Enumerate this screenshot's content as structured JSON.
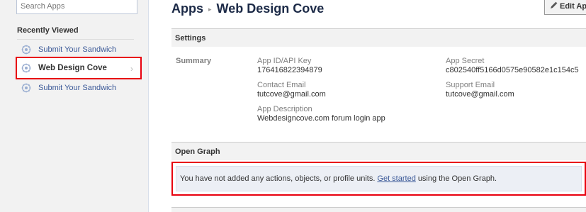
{
  "sidebar": {
    "search_placeholder": "Search Apps",
    "recent_heading": "Recently Viewed",
    "items": [
      {
        "label": "Submit Your Sandwich",
        "active": false
      },
      {
        "label": "Web Design Cove",
        "active": true
      },
      {
        "label": "Submit Your Sandwich",
        "active": false
      }
    ]
  },
  "header": {
    "apps": "Apps",
    "separator": "▸",
    "app_name": "Web Design Cove",
    "edit_label": "Edit Ap"
  },
  "settings": {
    "title": "Settings",
    "summary_label": "Summary",
    "app_id_label": "App ID/API Key",
    "app_id_value": "176416822394879",
    "app_secret_label": "App Secret",
    "app_secret_value": "c802540ff5166d0575e90582e1c154c5",
    "contact_email_label": "Contact Email",
    "contact_email_value": "tutcove@gmail.com",
    "support_email_label": "Support Email",
    "support_email_value": "tutcove@gmail.com",
    "description_label": "App Description",
    "description_value": "Webdesigncove.com forum login app"
  },
  "open_graph": {
    "title": "Open Graph",
    "message_before": "You have not added any actions, objects, or profile units.",
    "link": "Get started",
    "message_after": "using the Open Graph."
  },
  "colors": {
    "link": "#3b5998",
    "highlight": "#e8000e",
    "panel_bg": "#f2f2f2"
  }
}
